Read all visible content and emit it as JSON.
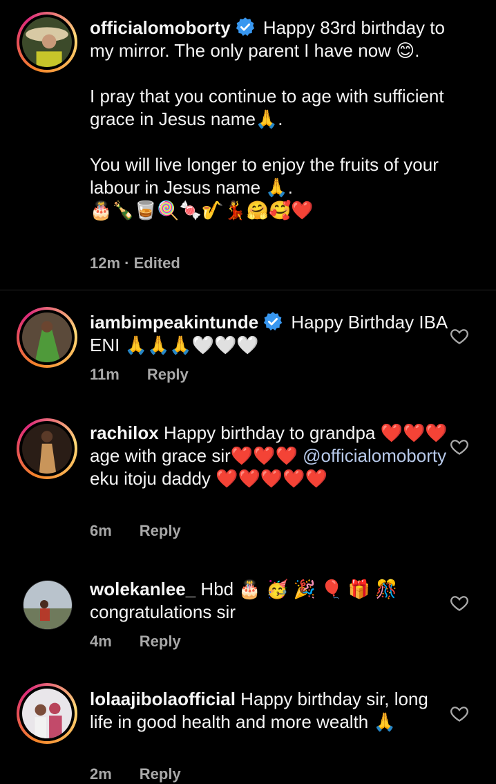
{
  "caption": {
    "username": "officialomoborty",
    "line1": " Happy 83rd birthday to my mirror. The only parent I have now 😊.",
    "line2": "I pray that you continue to age with sufficient grace in Jesus name🙏.",
    "line3": "You will live longer to enjoy the fruits of your labour in Jesus name 🙏.",
    "emoji_row": "🎂🍾🥃🍭🍬🎷💃🤗🥰❤️",
    "time": "12m",
    "edited": "Edited"
  },
  "comments": [
    {
      "username": "iambimpeakintunde",
      "verified": true,
      "text": " Happy Birthday IBA ENI 🙏🙏🙏🤍🤍🤍",
      "time": "11m",
      "reply": "Reply"
    },
    {
      "username": "rachilox",
      "text_before": " Happy birthday to grandpa ❤️❤️❤️ age with grace sir❤️❤️❤️ ",
      "mention": "@officialomoborty",
      "text_after": " eku itoju daddy ❤️❤️❤️❤️❤️",
      "time": "6m",
      "reply": "Reply"
    },
    {
      "username": "wolekanlee_",
      "text": " Hbd 🎂 🥳 🎉 🎈 🎁 🎊 congratulations sir",
      "time": "4m",
      "reply": "Reply"
    },
    {
      "username": "lolaajibolaofficial",
      "text": " Happy birthday sir, long life in good health and more wealth 🙏",
      "time": "2m",
      "reply": "Reply"
    }
  ],
  "colors": {
    "background": "#000000",
    "text": "#f5f5f5",
    "meta": "#a8a8a8",
    "mention": "#b7c9ea",
    "verified": "#3897f0"
  },
  "icons": {
    "verified": "verified-badge-icon",
    "like": "heart-outline-icon"
  }
}
